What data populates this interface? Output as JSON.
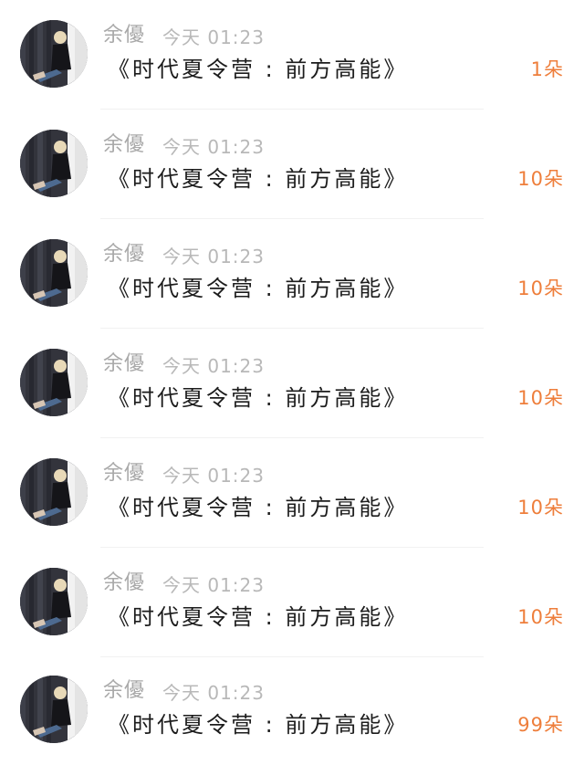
{
  "gift_list": {
    "items": [
      {
        "name": "余優",
        "time": "今天 01:23",
        "title": "《时代夏令营 : 前方高能》",
        "gift": "1朵"
      },
      {
        "name": "余優",
        "time": "今天 01:23",
        "title": "《时代夏令营 : 前方高能》",
        "gift": "10朵"
      },
      {
        "name": "余優",
        "time": "今天 01:23",
        "title": "《时代夏令营 : 前方高能》",
        "gift": "10朵"
      },
      {
        "name": "余優",
        "time": "今天 01:23",
        "title": "《时代夏令营 : 前方高能》",
        "gift": "10朵"
      },
      {
        "name": "余優",
        "time": "今天 01:23",
        "title": "《时代夏令营 : 前方高能》",
        "gift": "10朵"
      },
      {
        "name": "余優",
        "time": "今天 01:23",
        "title": "《时代夏令营 : 前方高能》",
        "gift": "10朵"
      },
      {
        "name": "余優",
        "time": "今天 01:23",
        "title": "《时代夏令营 : 前方高能》",
        "gift": "99朵"
      }
    ]
  },
  "colors": {
    "gift_accent": "#ee7e3b",
    "name_gray": "#a9a9a9",
    "title_text": "#1c1c1c"
  }
}
